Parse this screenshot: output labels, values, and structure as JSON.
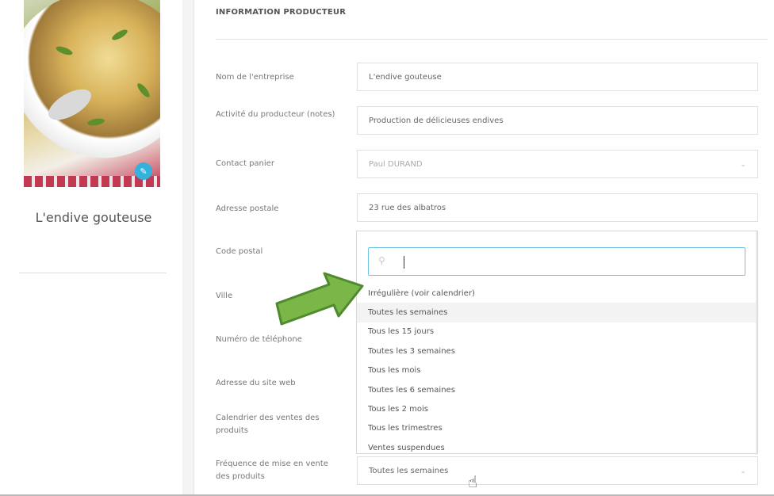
{
  "sidebar": {
    "company_name": "L'endive gouteuse",
    "photo_alt": "endive-gratin-photo",
    "edit_icon": "pencil-icon"
  },
  "form": {
    "section_title": "INFORMATION PRODUCTEUR",
    "fields": {
      "company": {
        "label": "Nom de l'entreprise",
        "value": "L'endive gouteuse"
      },
      "activity": {
        "label": "Activité du producteur (notes)",
        "value": "Production de délicieuses endives"
      },
      "contact": {
        "label": "Contact panier",
        "value": "Paul DURAND"
      },
      "address": {
        "label": "Adresse postale",
        "value": "23 rue des albatros"
      },
      "postal": {
        "label": "Code postal"
      },
      "city": {
        "label": "Ville"
      },
      "phone": {
        "label": "Numéro de téléphone"
      },
      "website": {
        "label": "Adresse du site web"
      },
      "calendar": {
        "label": "Calendrier des ventes des produits"
      },
      "frequency": {
        "label": "Fréquence de mise en vente des produits",
        "value": "Toutes les semaines"
      }
    }
  },
  "dropdown": {
    "search_value": "",
    "highlighted_index": 1,
    "options": [
      "Irrégulière (voir calendrier)",
      "Toutes les semaines",
      "Tous les 15 jours",
      "Toutes les 3 semaines",
      "Tous les mois",
      "Toutes les 6 semaines",
      "Tous les 2 mois",
      "Tous les trimestres",
      "Ventes suspendues"
    ]
  },
  "colors": {
    "accent": "#34b1dd",
    "arrow_fill": "#7ab648",
    "arrow_stroke": "#4f8a2e"
  }
}
